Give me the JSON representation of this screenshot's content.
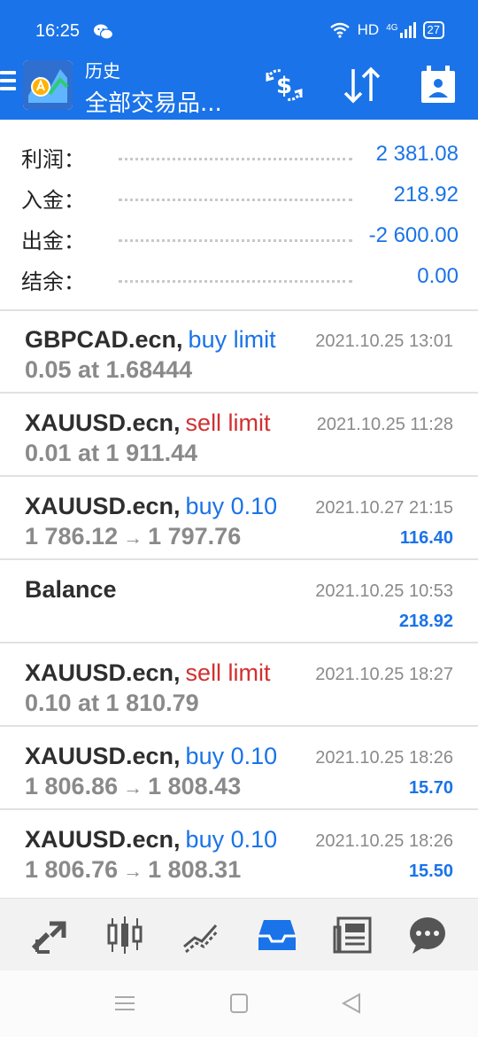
{
  "status_bar": {
    "time": "16:25",
    "network": "HD",
    "signal_label": "4G",
    "battery": "27",
    "icons": [
      "wechat-icon",
      "wifi-icon",
      "signal-icon",
      "battery-icon"
    ]
  },
  "header": {
    "title_small": "历史",
    "title_big": "全部交易品...",
    "buttons": [
      "currency-exchange-icon",
      "sort-icon",
      "calendar-icon"
    ],
    "accent": "#1a73e8"
  },
  "summary": [
    {
      "label": "利润：",
      "value": "2 381.08"
    },
    {
      "label": "入金：",
      "value": "218.92"
    },
    {
      "label": "出金：",
      "value": "-2 600.00"
    },
    {
      "label": "结余：",
      "value": "0.00"
    }
  ],
  "items": [
    {
      "symbol": "GBPCAD.ecn,",
      "type": "buy limit",
      "type_color": "buy",
      "detail": "0.05 at 1.68444",
      "time": "2021.10.25 13:01",
      "profit": ""
    },
    {
      "symbol": "XAUUSD.ecn,",
      "type": "sell limit",
      "type_color": "sell",
      "detail": "0.01 at 1 911.44",
      "time": "2021.10.25 11:28",
      "profit": ""
    },
    {
      "symbol": "XAUUSD.ecn,",
      "type": "buy 0.10",
      "type_color": "buy",
      "open": "1 786.12",
      "arrow": "→",
      "close": "1 797.76",
      "time": "2021.10.27 21:15",
      "profit": "116.40"
    },
    {
      "symbol": "Balance",
      "type": "",
      "type_color": "",
      "detail": "",
      "time": "2021.10.25 10:53",
      "profit": "218.92"
    },
    {
      "symbol": "XAUUSD.ecn,",
      "type": "sell limit",
      "type_color": "sell",
      "detail": "0.10 at 1 810.79",
      "time": "2021.10.25 18:27",
      "profit": ""
    },
    {
      "symbol": "XAUUSD.ecn,",
      "type": "buy 0.10",
      "type_color": "buy",
      "open": "1 806.86",
      "arrow": "→",
      "close": "1 808.43",
      "time": "2021.10.25 18:26",
      "profit": "15.70"
    },
    {
      "symbol": "XAUUSD.ecn,",
      "type": "buy 0.10",
      "type_color": "buy",
      "open": "1 806.76",
      "arrow": "→",
      "close": "1 808.31",
      "time": "2021.10.25 18:26",
      "profit": "15.50"
    }
  ],
  "bottom_nav": [
    {
      "name": "quotes-icon",
      "active": false
    },
    {
      "name": "chart-icon",
      "active": false
    },
    {
      "name": "trade-icon",
      "active": false
    },
    {
      "name": "history-icon",
      "active": true
    },
    {
      "name": "news-icon",
      "active": false
    },
    {
      "name": "messages-icon",
      "active": false
    }
  ],
  "system_nav": [
    "menu-icon",
    "home-icon",
    "back-icon"
  ]
}
